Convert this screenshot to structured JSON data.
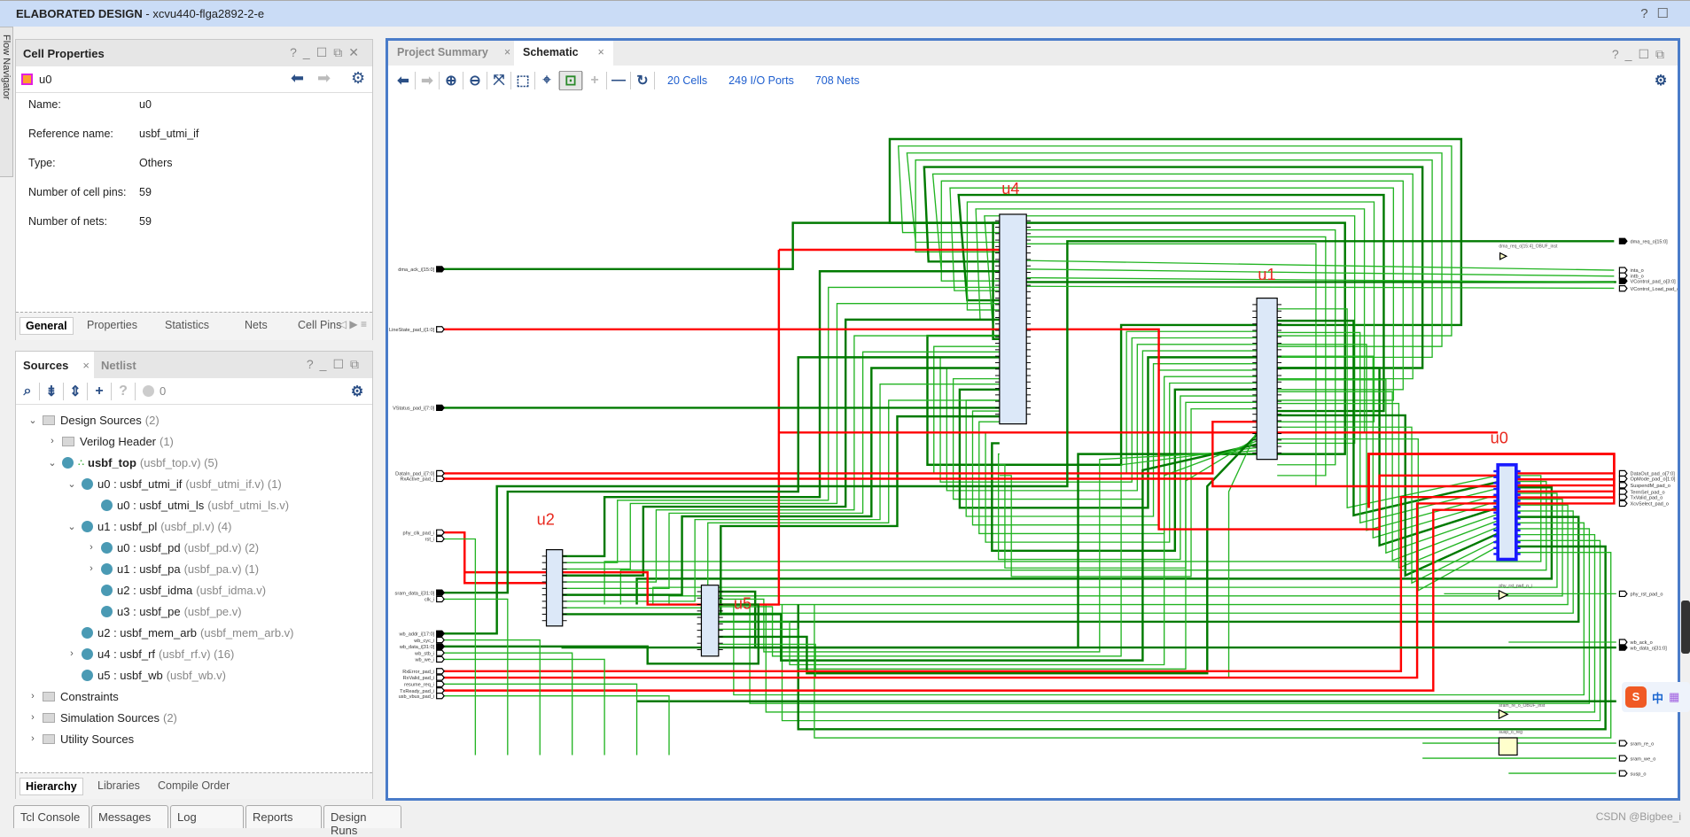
{
  "window": {
    "title_bold": "ELABORATED DESIGN",
    "title_rest": " - xcvu440-flga2892-2-e",
    "help": "?",
    "flow_navigator": "Flow Navigator"
  },
  "cell_properties": {
    "title": "Cell Properties",
    "cell": "u0",
    "properties": [
      {
        "label": "Name:",
        "value": "u0"
      },
      {
        "label": "Reference name:",
        "value": "usbf_utmi_if"
      },
      {
        "label": "Type:",
        "value": "Others"
      },
      {
        "label": "Number of cell pins:",
        "value": "59"
      },
      {
        "label": "Number of nets:",
        "value": "59"
      }
    ],
    "tabs": [
      "General",
      "Properties",
      "Statistics",
      "Nets",
      "Cell Pins"
    ],
    "active_tab": "General"
  },
  "sources": {
    "tabs": [
      "Sources",
      "Netlist"
    ],
    "active_tab": "Sources",
    "count": "0",
    "tree": [
      {
        "level": 0,
        "exp": "open",
        "icon": "folder",
        "name": "Design Sources",
        "extra": "(2)"
      },
      {
        "level": 1,
        "exp": "closed",
        "icon": "folder",
        "name": "Verilog Header",
        "extra": "(1)"
      },
      {
        "level": 1,
        "exp": "open",
        "icon": "dot-top",
        "name": "usbf_top",
        "extra": "(usbf_top.v) (5)",
        "bold": true
      },
      {
        "level": 2,
        "exp": "open",
        "icon": "dot",
        "name": "u0 : usbf_utmi_if",
        "extra": "(usbf_utmi_if.v) (1)"
      },
      {
        "level": 3,
        "exp": "none",
        "icon": "dot",
        "name": "u0 : usbf_utmi_ls",
        "extra": "(usbf_utmi_ls.v)"
      },
      {
        "level": 2,
        "exp": "open",
        "icon": "dot",
        "name": "u1 : usbf_pl",
        "extra": "(usbf_pl.v) (4)"
      },
      {
        "level": 3,
        "exp": "closed",
        "icon": "dot",
        "name": "u0 : usbf_pd",
        "extra": "(usbf_pd.v) (2)"
      },
      {
        "level": 3,
        "exp": "closed",
        "icon": "dot",
        "name": "u1 : usbf_pa",
        "extra": "(usbf_pa.v) (1)"
      },
      {
        "level": 3,
        "exp": "none",
        "icon": "dot",
        "name": "u2 : usbf_idma",
        "extra": "(usbf_idma.v)"
      },
      {
        "level": 3,
        "exp": "none",
        "icon": "dot",
        "name": "u3 : usbf_pe",
        "extra": "(usbf_pe.v)"
      },
      {
        "level": 2,
        "exp": "none",
        "icon": "dot",
        "name": "u2 : usbf_mem_arb",
        "extra": "(usbf_mem_arb.v)"
      },
      {
        "level": 2,
        "exp": "closed",
        "icon": "dot",
        "name": "u4 : usbf_rf",
        "extra": "(usbf_rf.v) (16)"
      },
      {
        "level": 2,
        "exp": "none",
        "icon": "dot",
        "name": "u5 : usbf_wb",
        "extra": "(usbf_wb.v)"
      },
      {
        "level": 0,
        "exp": "closed",
        "icon": "folder",
        "name": "Constraints",
        "extra": ""
      },
      {
        "level": 0,
        "exp": "closed",
        "icon": "folder",
        "name": "Simulation Sources",
        "extra": "(2)"
      },
      {
        "level": 0,
        "exp": "closed",
        "icon": "folder",
        "name": "Utility Sources",
        "extra": ""
      }
    ],
    "bottom_tabs": [
      "Hierarchy",
      "Libraries",
      "Compile Order"
    ],
    "active_bottom_tab": "Hierarchy"
  },
  "schematic": {
    "tabs": [
      "Project Summary",
      "Schematic"
    ],
    "active_tab": "Schematic",
    "cells": "20 Cells",
    "io_ports": "249 I/O Ports",
    "nets": "708 Nets",
    "colors": {
      "net": "#22b422",
      "bus": "#007a00",
      "highlight": "#ff0000",
      "selected": "#1a1aff",
      "cell_fill": "#dce8f8"
    },
    "instances": [
      {
        "name": "u4"
      },
      {
        "name": "u1"
      },
      {
        "name": "u0"
      },
      {
        "name": "u2"
      },
      {
        "name": "u5"
      }
    ],
    "inputs": [
      {
        "name": "dma_ack_i[15:0]",
        "net": "bus"
      },
      {
        "name": "LineState_pad_i[1:0]",
        "net": "highlight"
      },
      {
        "name": "VStatus_pad_i[7:0]",
        "net": "bus"
      },
      {
        "name": "DataIn_pad_i[7:0]",
        "net": "highlight"
      },
      {
        "name": "RxActive_pad_i",
        "net": "highlight"
      },
      {
        "name": "phy_clk_pad_i",
        "net": "highlight"
      },
      {
        "name": "rst_i",
        "net": "net"
      },
      {
        "name": "sram_data_i[31:0]",
        "net": "bus"
      },
      {
        "name": "clk_i",
        "net": "net"
      },
      {
        "name": "wb_addr_i[17:0]",
        "net": "bus"
      },
      {
        "name": "wb_cyc_i",
        "net": "net"
      },
      {
        "name": "wb_data_i[31:0]",
        "net": "bus"
      },
      {
        "name": "wb_stb_i",
        "net": "net"
      },
      {
        "name": "wb_we_i",
        "net": "net"
      },
      {
        "name": "RxError_pad_i",
        "net": "highlight"
      },
      {
        "name": "RxValid_pad_i",
        "net": "highlight"
      },
      {
        "name": "resume_req_i",
        "net": "net"
      },
      {
        "name": "TxReady_pad_i",
        "net": "highlight"
      },
      {
        "name": "usb_vbus_pad_i",
        "net": "net"
      }
    ],
    "outputs": [
      {
        "name": "dma_req_o[15:0]",
        "net": "bus"
      },
      {
        "name": "inta_o",
        "net": "net"
      },
      {
        "name": "intb_o",
        "net": "net"
      },
      {
        "name": "VControl_pad_o[3:0]",
        "net": "bus"
      },
      {
        "name": "VControl_Load_pad_o",
        "net": "net"
      },
      {
        "name": "DataOut_pad_o[7:0]",
        "net": "highlight"
      },
      {
        "name": "OpMode_pad_o[1:0]",
        "net": "highlight"
      },
      {
        "name": "SuspendM_pad_o",
        "net": "highlight"
      },
      {
        "name": "TermSel_pad_o",
        "net": "highlight"
      },
      {
        "name": "TxValid_pad_o",
        "net": "highlight"
      },
      {
        "name": "XcvSelect_pad_o",
        "net": "highlight"
      },
      {
        "name": "phy_rst_pad_o",
        "net": "net"
      },
      {
        "name": "wb_ack_o",
        "net": "net"
      },
      {
        "name": "wb_data_o[31:0]",
        "net": "bus"
      },
      {
        "name": "sram_re_o",
        "net": "net"
      },
      {
        "name": "sram_we_o",
        "net": "net"
      },
      {
        "name": "susp_o",
        "net": "net"
      }
    ],
    "prims": [
      {
        "name": "dma_req_o[15:4]_OBUF_inst"
      },
      {
        "name": "phy_rst_pad_o_i"
      },
      {
        "name": "sram_re_o_OBUF_inst"
      },
      {
        "name": "susp_o_reg"
      }
    ]
  },
  "bottom_tabs": [
    "Tcl Console",
    "Messages",
    "Log",
    "Reports",
    "Design Runs"
  ],
  "watermark": "CSDN @Bigbee_i",
  "ime": {
    "label": "中"
  }
}
